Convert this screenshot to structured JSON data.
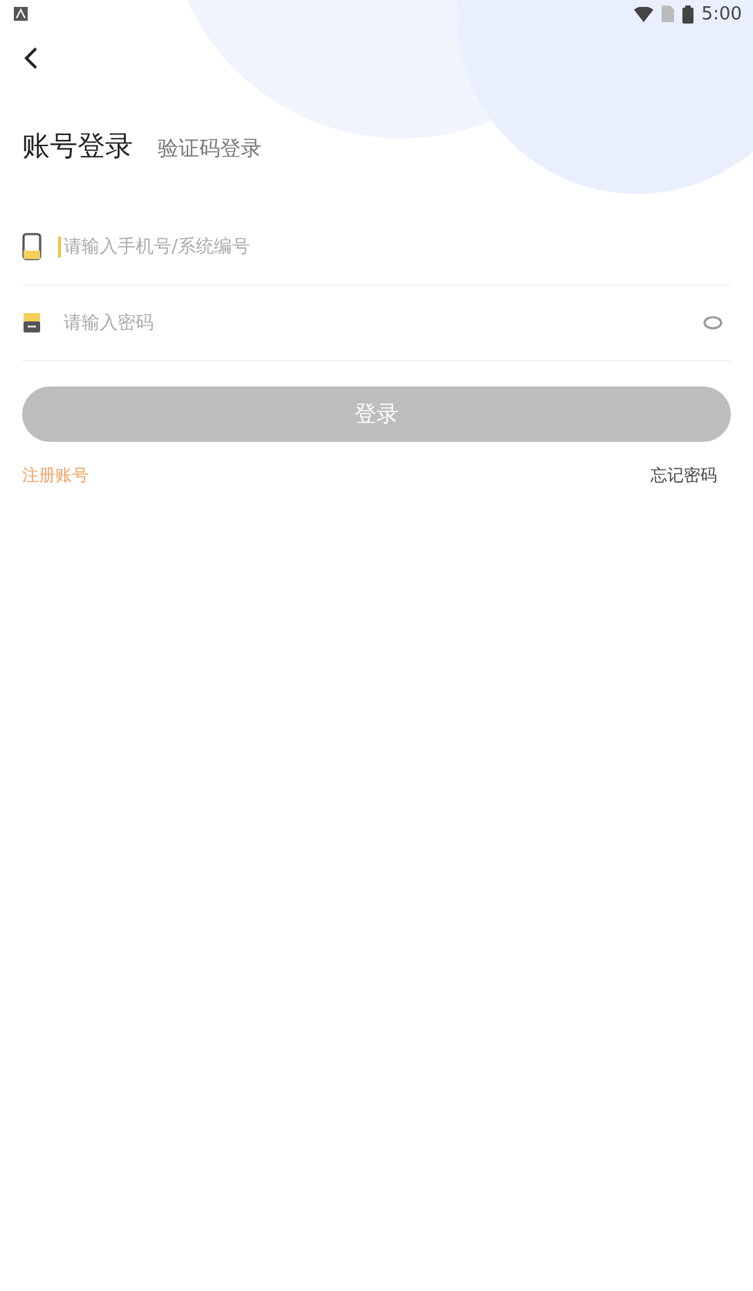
{
  "status_bar": {
    "time": "5:00"
  },
  "tabs": [
    {
      "label": "账号登录",
      "selected": true
    },
    {
      "label": "验证码登录",
      "selected": false
    }
  ],
  "fields": [
    {
      "kind": "phone",
      "placeholder": "请输入手机号/系统编号",
      "focused": true
    },
    {
      "kind": "password",
      "placeholder": "请输入密码",
      "focused": false
    }
  ],
  "login_button": {
    "label": "登录",
    "disabled": true
  },
  "links": {
    "register": "注册账号",
    "forgot": "忘记密码"
  }
}
